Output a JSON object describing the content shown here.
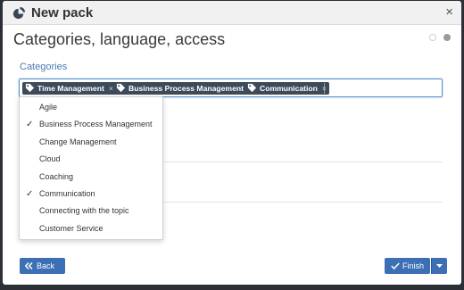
{
  "modal": {
    "title": "New pack",
    "close_symbol": "×",
    "step_title": "Categories, language, access"
  },
  "categories": {
    "label": "Categories",
    "selected_tags": [
      {
        "label": "Time Management",
        "remove": "×"
      },
      {
        "label": "Business Process Management",
        "remove": "×"
      },
      {
        "label": "Communication",
        "remove": "×"
      }
    ],
    "options": [
      {
        "label": "Agile",
        "checked": false
      },
      {
        "label": "Business Process Management",
        "checked": true
      },
      {
        "label": "Change Management",
        "checked": false
      },
      {
        "label": "Cloud",
        "checked": false
      },
      {
        "label": "Coaching",
        "checked": false
      },
      {
        "label": "Communication",
        "checked": true
      },
      {
        "label": "Connecting with the topic",
        "checked": false
      },
      {
        "label": "Customer Service",
        "checked": false
      }
    ],
    "check_symbol": "✓"
  },
  "footer": {
    "back_label": "Back",
    "finish_label": "Finish"
  },
  "icons": {
    "header": "pie-chart-icon",
    "tag": "tag-icon",
    "back": "double-chevron-left-icon",
    "finish": "check-icon",
    "caret": "caret-down-icon"
  },
  "colors": {
    "primary": "#3c6fb4",
    "tag_bg": "#3c4a5a",
    "label": "#4a7bb0"
  }
}
